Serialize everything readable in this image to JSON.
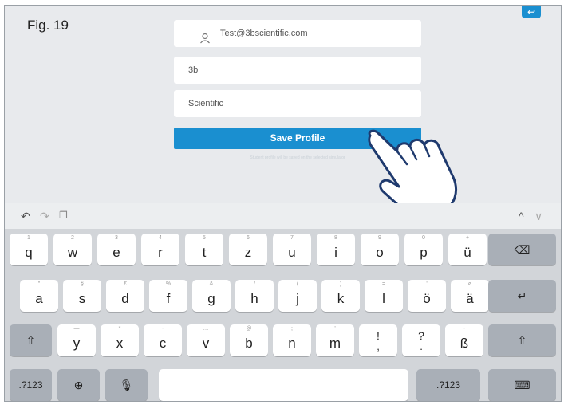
{
  "figure_label": "Fig. 19",
  "form": {
    "email_value": "Test@3bscientific.com",
    "first_name_value": "3b",
    "last_name_value": "Scientific",
    "save_label": "Save Profile",
    "note": "Student profile will be saved on the selected simulator"
  },
  "toolbar": {
    "undo_icon": "undo-icon",
    "redo_icon": "redo-icon",
    "clipboard_icon": "clipboard-icon",
    "up_arrow": "^",
    "down_arrow": "∨"
  },
  "keyboard": {
    "row1": [
      {
        "main": "q",
        "sub": "1"
      },
      {
        "main": "w",
        "sub": "2"
      },
      {
        "main": "e",
        "sub": "3"
      },
      {
        "main": "r",
        "sub": "4"
      },
      {
        "main": "t",
        "sub": "5"
      },
      {
        "main": "z",
        "sub": "6"
      },
      {
        "main": "u",
        "sub": "7"
      },
      {
        "main": "i",
        "sub": "8"
      },
      {
        "main": "o",
        "sub": "9"
      },
      {
        "main": "p",
        "sub": "0"
      },
      {
        "main": "ü",
        "sub": "+"
      }
    ],
    "row2": [
      {
        "main": "a",
        "sub": "\""
      },
      {
        "main": "s",
        "sub": "§"
      },
      {
        "main": "d",
        "sub": "€"
      },
      {
        "main": "f",
        "sub": "%"
      },
      {
        "main": "g",
        "sub": "&"
      },
      {
        "main": "h",
        "sub": "/"
      },
      {
        "main": "j",
        "sub": "("
      },
      {
        "main": "k",
        "sub": ")"
      },
      {
        "main": "l",
        "sub": "="
      },
      {
        "main": "ö",
        "sub": "'"
      },
      {
        "main": "ä",
        "sub": "ø"
      }
    ],
    "row3": [
      {
        "main": "y",
        "sub": "—"
      },
      {
        "main": "x",
        "sub": "*"
      },
      {
        "main": "c",
        "sub": "-"
      },
      {
        "main": "v",
        "sub": "…"
      },
      {
        "main": "b",
        "sub": "@"
      },
      {
        "main": "n",
        "sub": ";"
      },
      {
        "main": "m",
        "sub": "'"
      },
      {
        "main": "!",
        "sub": ",",
        "stack": true
      },
      {
        "main": "?",
        "sub": ".",
        "stack": true
      },
      {
        "main": "ß",
        "sub": "-"
      }
    ],
    "numbers_label": ".?123",
    "numbers_label_right": ".?123"
  }
}
